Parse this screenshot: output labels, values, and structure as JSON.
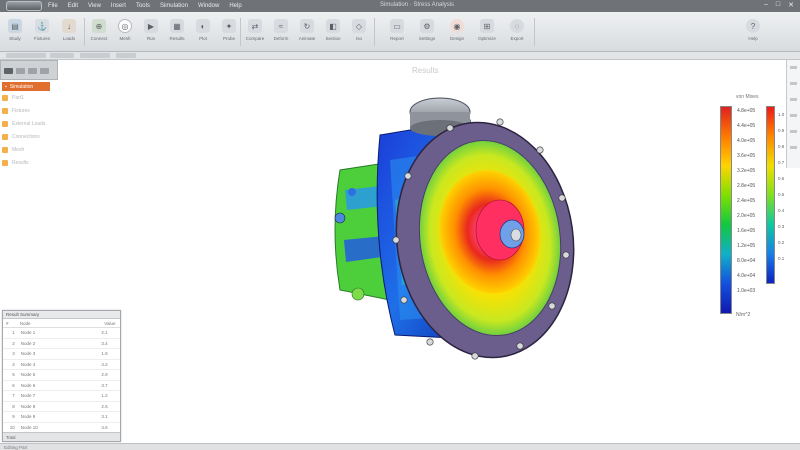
{
  "window": {
    "title": "Simulation · Stress Analysis",
    "menu": [
      "File",
      "Edit",
      "View",
      "Insert",
      "Tools",
      "Simulation",
      "Window",
      "Help"
    ]
  },
  "ribbon": {
    "buttons": [
      {
        "label": "Study",
        "icon": "study-icon"
      },
      {
        "label": "Fixtures",
        "icon": "fixture-icon"
      },
      {
        "label": "Loads",
        "icon": "load-icon"
      },
      {
        "label": "Connect",
        "icon": "connect-icon"
      },
      {
        "label": "Mesh",
        "icon": "mesh-icon"
      },
      {
        "label": "Run",
        "icon": "run-icon"
      },
      {
        "label": "Results",
        "icon": "results-icon"
      },
      {
        "label": "Plot",
        "icon": "plot-icon"
      },
      {
        "label": "Probe",
        "icon": "probe-icon"
      },
      {
        "label": "Compare",
        "icon": "compare-icon"
      },
      {
        "label": "Deform",
        "icon": "deform-icon"
      },
      {
        "label": "Animate",
        "icon": "animate-icon"
      },
      {
        "label": "Section",
        "icon": "section-icon"
      },
      {
        "label": "Iso",
        "icon": "iso-icon"
      },
      {
        "label": "Report",
        "icon": "report-icon"
      },
      {
        "label": "Settings",
        "icon": "settings-icon"
      },
      {
        "label": "Design",
        "icon": "design-icon"
      },
      {
        "label": "Optimize",
        "icon": "optimize-icon"
      },
      {
        "label": "Export",
        "icon": "export-icon"
      },
      {
        "label": "Help",
        "icon": "help-icon"
      }
    ]
  },
  "feature_tree": {
    "root": "Simulation",
    "items": [
      "Part1",
      "Fixtures",
      "External Loads",
      "Connections",
      "Mesh",
      "Results"
    ]
  },
  "viewport": {
    "label": "Results"
  },
  "legend": {
    "title": "von Mises",
    "values": [
      "4.8e+05",
      "4.4e+05",
      "4.0e+05",
      "3.6e+05",
      "3.2e+05",
      "2.8e+05",
      "2.4e+05",
      "2.0e+05",
      "1.6e+05",
      "1.2e+05",
      "8.0e+04",
      "4.0e+04",
      "1.0e+03"
    ],
    "values_secondary": [
      "1.0",
      "0.9",
      "0.8",
      "0.7",
      "0.6",
      "0.5",
      "0.4",
      "0.3",
      "0.2",
      "0.1"
    ],
    "unit": "N/m^2",
    "colors": [
      "#e02020",
      "#ff7a00",
      "#ffd400",
      "#7ee000",
      "#10c840",
      "#10b0c8",
      "#1450e0",
      "#1018b0"
    ]
  },
  "results_table": {
    "title": "Result Summary",
    "columns": [
      "#",
      "Node",
      "Value"
    ],
    "rows": [
      [
        "1",
        "Node 1",
        "2.1"
      ],
      [
        "2",
        "Node 2",
        "3.4"
      ],
      [
        "3",
        "Node 3",
        "1.8"
      ],
      [
        "4",
        "Node 4",
        "4.2"
      ],
      [
        "5",
        "Node 5",
        "2.9"
      ],
      [
        "6",
        "Node 6",
        "3.7"
      ],
      [
        "7",
        "Node 7",
        "1.2"
      ],
      [
        "8",
        "Node 8",
        "2.5"
      ],
      [
        "9",
        "Node 9",
        "3.1"
      ],
      [
        "10",
        "Node 10",
        "4.6"
      ]
    ],
    "footer": "Total"
  },
  "statusbar": {
    "text": "Editing Part"
  }
}
